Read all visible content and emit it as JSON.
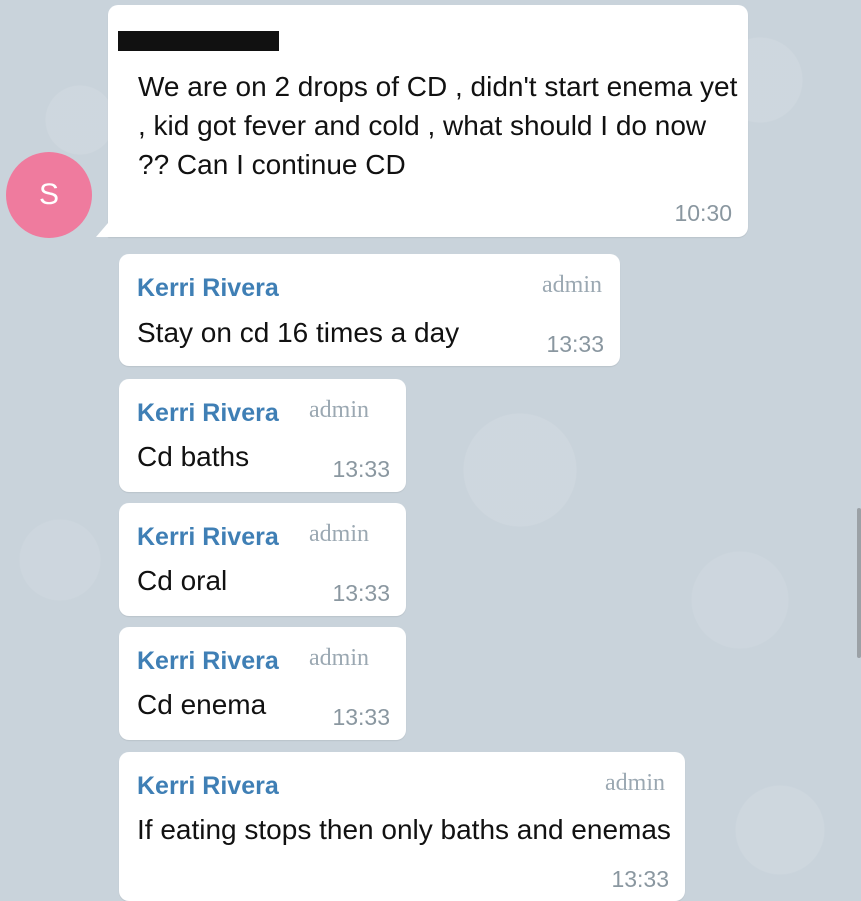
{
  "avatar": {
    "initial": "S",
    "color": "#ef7b9e"
  },
  "messages": [
    {
      "text": "We are on 2 drops of CD , didn't start enema yet , kid got fever and cold , what should I do now ?? Can I continue CD",
      "time": "10:30"
    },
    {
      "sender": "Kerri Rivera",
      "role": "admin",
      "text": "Stay on cd 16 times a day",
      "time": "13:33"
    },
    {
      "sender": "Kerri Rivera",
      "role": "admin",
      "text": "Cd baths",
      "time": "13:33"
    },
    {
      "sender": "Kerri Rivera",
      "role": "admin",
      "text": "Cd oral",
      "time": "13:33"
    },
    {
      "sender": "Kerri Rivera",
      "role": "admin",
      "text": "Cd enema",
      "time": "13:33"
    },
    {
      "sender": "Kerri Rivera",
      "role": "admin",
      "text": "If eating stops then only baths and enemas",
      "time": "13:33"
    }
  ],
  "colors": {
    "background": "#c9d3db",
    "bubble": "#ffffff",
    "sender_name": "#3f7fb5",
    "meta_text": "#8a97a0"
  }
}
